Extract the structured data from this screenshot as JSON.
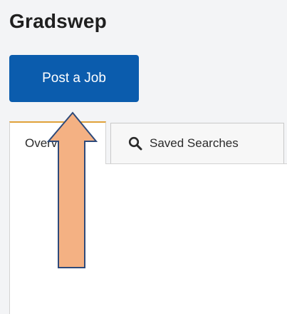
{
  "header": {
    "title": "Gradswep"
  },
  "actions": {
    "post_job_label": "Post a Job"
  },
  "tabs": [
    {
      "label": "Overview"
    },
    {
      "label": "Saved Searches",
      "icon": "search-icon"
    }
  ],
  "colors": {
    "primary_button": "#0b5cad",
    "active_tab_accent": "#e0a23a",
    "annotation_arrow_fill": "#f4b183",
    "annotation_arrow_stroke": "#2e4a7a"
  }
}
